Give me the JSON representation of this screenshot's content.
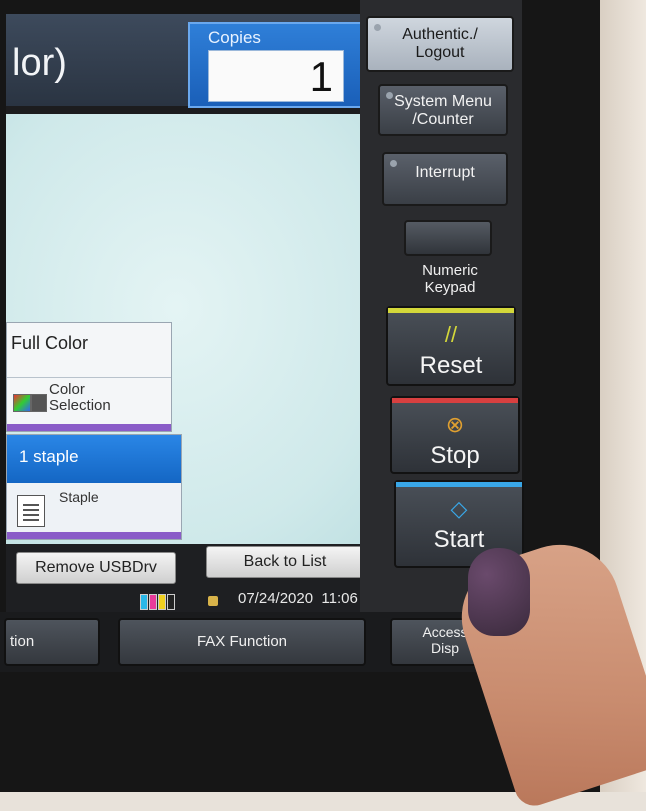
{
  "header": {
    "title_fragment": "lor)",
    "copies_label": "Copies",
    "copies_value": "1"
  },
  "panels": {
    "color_mode": "Full Color",
    "color_selection_label": "Color\nSelection",
    "staple_value": "1 staple",
    "staple_label": "Staple"
  },
  "bottom": {
    "remove_usb": "Remove USBDrv",
    "back_to_list": "Back to List",
    "date": "07/24/2020",
    "time": "11:06"
  },
  "hardware": {
    "authentic_logout": "Authentic./\nLogout",
    "system_menu": "System Menu\n/Counter",
    "interrupt": "Interrupt",
    "numeric_keypad": "Numeric\nKeypad",
    "reset": "Reset",
    "stop": "Stop",
    "start": "Start"
  },
  "function_bar": {
    "left_fragment": "tion",
    "fax_function": "FAX Function",
    "access_fragment": "Access\nDisp"
  },
  "colors": {
    "reset_strip": "#d4d83a",
    "stop_strip": "#d84040",
    "start_strip": "#39a7e8",
    "copies_blue": "#1a5fb8"
  }
}
